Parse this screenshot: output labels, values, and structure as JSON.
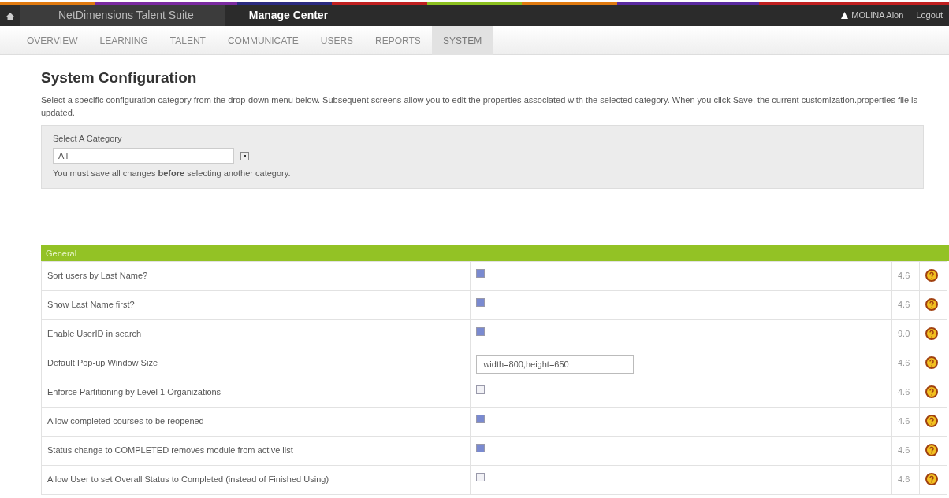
{
  "topbar": {
    "suite": "NetDimensions Talent Suite",
    "center": "Manage Center",
    "user": "MOLINA Alon",
    "logout": "Logout"
  },
  "tabs": [
    {
      "label": "OVERVIEW",
      "selected": false
    },
    {
      "label": "LEARNING",
      "selected": false
    },
    {
      "label": "TALENT",
      "selected": false
    },
    {
      "label": "COMMUNICATE",
      "selected": false
    },
    {
      "label": "USERS",
      "selected": false
    },
    {
      "label": "REPORTS",
      "selected": false
    },
    {
      "label": "SYSTEM",
      "selected": true
    }
  ],
  "page": {
    "title": "System Configuration",
    "description": "Select a specific configuration category from the drop-down menu below. Subsequent screens allow you to edit the properties associated with the selected category. When you click Save, the current customization.properties file is updated."
  },
  "category": {
    "label": "Select A Category",
    "value": "All",
    "note": "You must save all changes **before** selecting another category."
  },
  "section": "General",
  "rows": [
    {
      "label": "Sort users by Last Name?",
      "kind": "checkbox",
      "checked": true,
      "version": "4.6"
    },
    {
      "label": "Show Last Name first?",
      "kind": "checkbox",
      "checked": true,
      "version": "4.6"
    },
    {
      "label": "Enable UserID in search",
      "kind": "checkbox",
      "checked": true,
      "version": "9.0"
    },
    {
      "label": "Default Pop-up Window Size",
      "kind": "text",
      "value": "width=800,height=650",
      "version": "4.6"
    },
    {
      "label": "Enforce Partitioning by Level 1 Organizations",
      "kind": "checkbox",
      "checked": false,
      "version": "4.6"
    },
    {
      "label": "Allow completed courses to be reopened",
      "kind": "checkbox",
      "checked": true,
      "version": "4.6"
    },
    {
      "label": "Status change to COMPLETED removes module from active list",
      "kind": "checkbox",
      "checked": true,
      "version": "4.6"
    },
    {
      "label": "Allow User to set Overall Status to Completed (instead of Finished Using)",
      "kind": "checkbox",
      "checked": false,
      "version": "4.6"
    }
  ]
}
